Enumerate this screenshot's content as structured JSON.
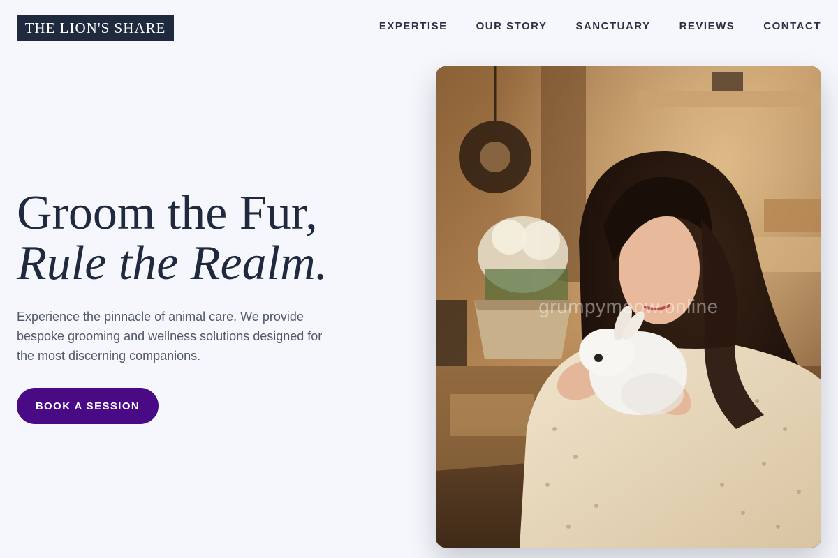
{
  "brand": {
    "logo_text": "THE LION'S SHARE"
  },
  "nav": {
    "items": [
      {
        "label": "EXPERTISE"
      },
      {
        "label": "OUR STORY"
      },
      {
        "label": "SANCTUARY"
      },
      {
        "label": "REVIEWS"
      },
      {
        "label": "CONTACT"
      }
    ]
  },
  "hero": {
    "title_line1": "Groom the Fur,",
    "title_line2": "Rule the Realm.",
    "description": "Experience the pinnacle of animal care. We provide bespoke grooming and wellness solutions designed for the most discerning companions.",
    "cta_label": "BOOK A SESSION",
    "image_watermark": "grumpymeow.online"
  },
  "colors": {
    "background": "#f6f7fc",
    "logo_bg": "#1f2a3f",
    "heading": "#1f2a3f",
    "body_text": "#4f5768",
    "cta_bg": "#4a0a85"
  }
}
